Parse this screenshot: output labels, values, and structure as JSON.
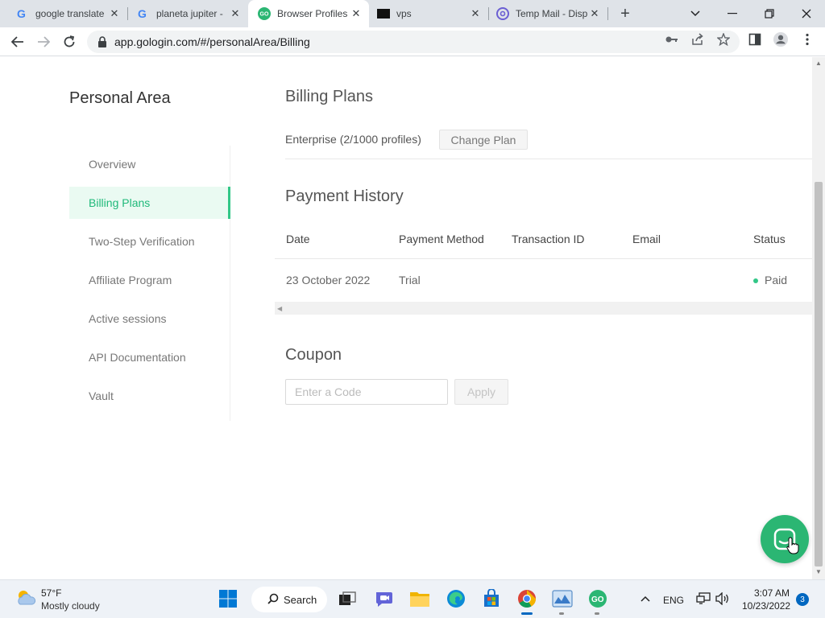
{
  "browser": {
    "tabs": [
      {
        "title": "google translate",
        "favicon": "google-icon",
        "active": false
      },
      {
        "title": "planeta jupiter -",
        "favicon": "google-icon",
        "active": false
      },
      {
        "title": "Browser Profiles",
        "favicon": "gologin-icon",
        "active": true
      },
      {
        "title": "vps",
        "favicon": "black-square-icon",
        "active": false
      },
      {
        "title": "Temp Mail - Disp",
        "favicon": "at-sign-icon",
        "active": false
      }
    ],
    "url": "app.gologin.com/#/personalArea/Billing"
  },
  "page": {
    "area_title": "Personal Area",
    "sidebar": {
      "items": [
        {
          "label": "Overview",
          "active": false
        },
        {
          "label": "Billing Plans",
          "active": true
        },
        {
          "label": "Two-Step Verification",
          "active": false
        },
        {
          "label": "Affiliate Program",
          "active": false
        },
        {
          "label": "Active sessions",
          "active": false
        },
        {
          "label": "API Documentation",
          "active": false
        },
        {
          "label": "Vault",
          "active": false
        }
      ]
    },
    "billing": {
      "title": "Billing Plans",
      "plan": "Enterprise (2/1000 profiles)",
      "change_plan_label": "Change Plan"
    },
    "payment_history": {
      "title": "Payment History",
      "columns": [
        "Date",
        "Payment Method",
        "Transaction ID",
        "Email",
        "Status"
      ],
      "rows": [
        {
          "date": "23 October 2022",
          "method": "Trial",
          "transaction_id": "",
          "email": "",
          "status": "Paid"
        }
      ]
    },
    "coupon": {
      "title": "Coupon",
      "placeholder": "Enter a Code",
      "value": "",
      "apply_label": "Apply"
    }
  },
  "taskbar": {
    "weather": {
      "temp": "57°F",
      "desc": "Mostly cloudy"
    },
    "search_label": "Search",
    "language": "ENG",
    "time": "3:07 AM",
    "date": "10/23/2022",
    "notification_count": "3"
  },
  "colors": {
    "accent": "#32c787",
    "accent_text": "#1fb97a",
    "accent_bg": "#eafaf2",
    "status_paid": "#32c787",
    "chat_bubble": "#2bb673"
  }
}
